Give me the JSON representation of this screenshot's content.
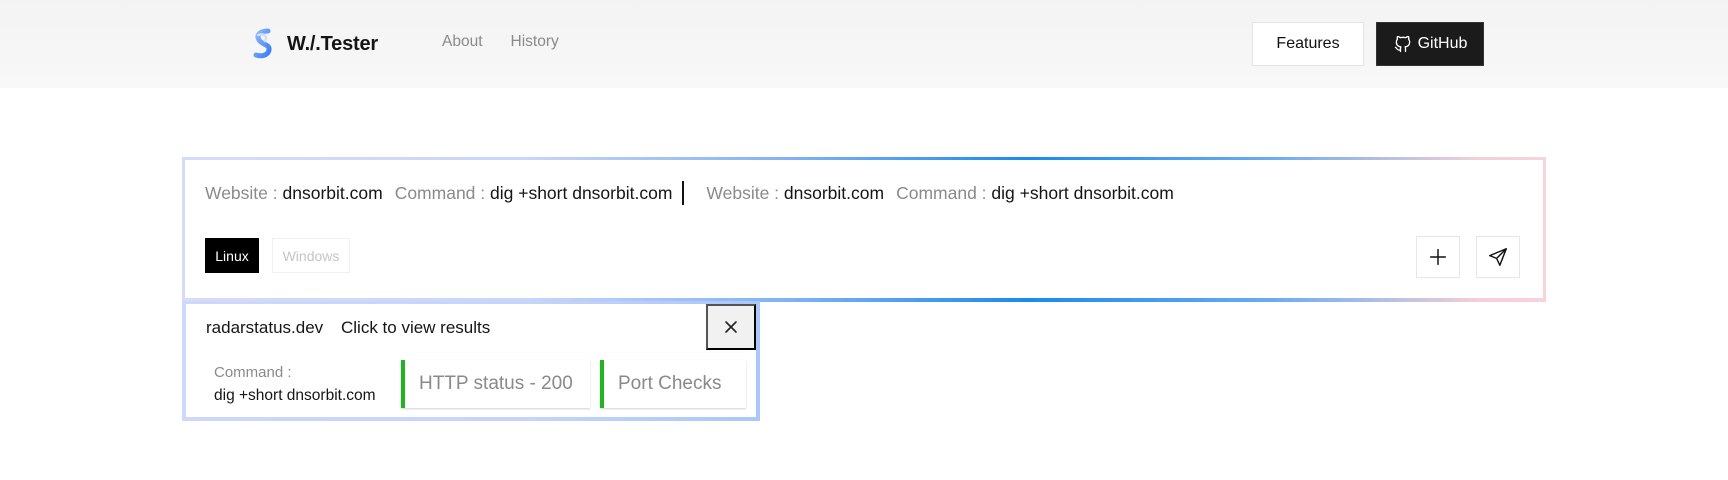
{
  "header": {
    "brand": "W./.Tester",
    "nav": [
      "About",
      "History"
    ],
    "features_label": "Features",
    "github_label": "GitHub"
  },
  "panel": {
    "entries": [
      {
        "website_label": "Website :",
        "website": "dnsorbit.com",
        "command_label": "Command :",
        "command": "dig +short dnsorbit.com"
      },
      {
        "website_label": "Website :",
        "website": "dnsorbit.com",
        "command_label": "Command :",
        "command": "dig +short dnsorbit.com"
      }
    ],
    "os_options": [
      "Linux",
      "Windows"
    ],
    "selected_os": "Linux"
  },
  "result": {
    "domain": "radarstatus.dev",
    "hint": "Click to view results",
    "command_label": "Command :",
    "command": "dig +short dnsorbit.com",
    "chips": [
      "HTTP status - 200",
      "Port Checks"
    ]
  },
  "colors": {
    "accent_blue": "#1a8af0",
    "status_green": "#22b322",
    "selected_os_bg": "#000000"
  }
}
